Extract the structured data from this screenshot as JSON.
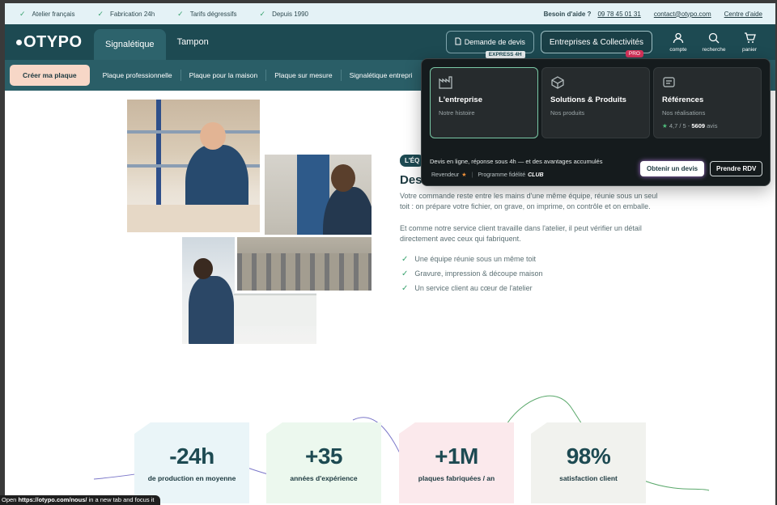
{
  "topbar": {
    "perks": [
      "Atelier français",
      "Fabrication 24h",
      "Tarifs dégressifs",
      "Depuis 1990"
    ],
    "help_label": "Besoin d'aide ?",
    "phone": "09 78 45 01 31",
    "email": "contact@otypo.com",
    "help_center": "Centre d'aide"
  },
  "nav": {
    "logo": "OTYPO",
    "tabs": [
      "Signalétique",
      "Tampon"
    ],
    "devis_label": "Demande de devis",
    "devis_badge": "EXPRESS 4H",
    "entreprises_label": "Entreprises & Collectivités",
    "pro_badge": "PRO",
    "compte": "compte",
    "recherche": "recherche",
    "panier": "panier"
  },
  "subnav": {
    "cta": "Créer ma plaque",
    "items": [
      "Plaque professionnelle",
      "Plaque pour la maison",
      "Plaque sur mesure",
      "Signalétique entrepri"
    ]
  },
  "dropdown": {
    "cards": [
      {
        "title": "L'entreprise",
        "sub": "Notre histoire",
        "icon": "factory-icon"
      },
      {
        "title": "Solutions & Produits",
        "sub": "Nos produits",
        "icon": "box-icon"
      },
      {
        "title": "Références",
        "sub": "Nos réalisations",
        "icon": "quote-icon"
      }
    ],
    "rating": "4,7 / 5 -",
    "reviews_count": "5609",
    "reviews_label": "avis",
    "promo": "Devis en ligne, réponse sous 4h — et des avantages accumulés",
    "revendeur": "Revendeur",
    "fidelite": "Programme fidélité",
    "club": "CLUB",
    "btn_devis": "Obtenir un devis",
    "btn_rdv": "Prendre RDV"
  },
  "hero": {
    "badge": "L'ÉQ",
    "title": "Des",
    "para1": "Votre commande reste entre les mains d'une même équipe, réunie sous un seul toit : on prépare votre fichier, on grave, on imprime, on contrôle et on emballe.",
    "para2": "Et comme notre service client travaille dans l'atelier, il peut vérifier un détail directement avec ceux qui fabriquent.",
    "checks": [
      "Une équipe réunie sous un même toit",
      "Gravure, impression & découpe maison",
      "Un service client au cœur de l'atelier"
    ]
  },
  "stats": [
    {
      "num": "-24h",
      "label": "de production en moyenne"
    },
    {
      "num": "+35",
      "label": "années d'expérience"
    },
    {
      "num": "+1M",
      "label": "plaques fabriquées / an"
    },
    {
      "num": "98%",
      "label": "satisfaction client"
    }
  ],
  "statusbar": {
    "open": "Open",
    "url": "https://otypo.com/nous/",
    "rest": "in a new tab and focus it"
  },
  "colors": {
    "primary": "#1d4a52",
    "accent_green": "#3aa36f",
    "cta_peach": "#f7d7c7",
    "pro_pink": "#d6335b"
  }
}
